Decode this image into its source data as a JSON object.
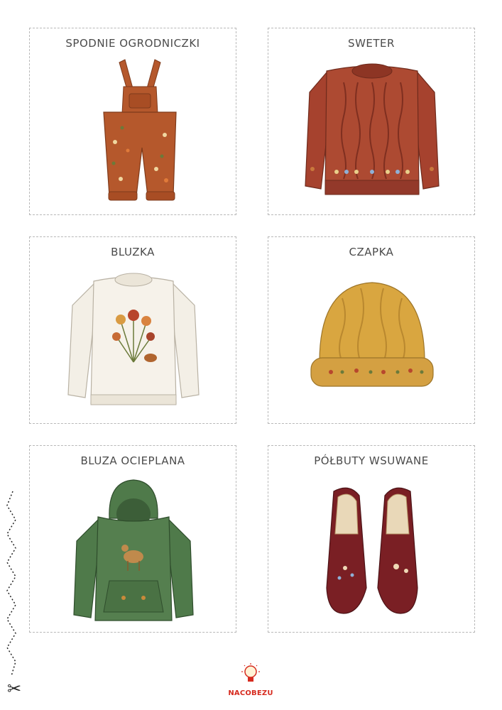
{
  "cards": [
    {
      "label": "SPODNIE OGRODNICZKI",
      "illustration": "overalls"
    },
    {
      "label": "SWETER",
      "illustration": "cable-sweater"
    },
    {
      "label": "BLUZKA",
      "illustration": "sweatshirt"
    },
    {
      "label": "CZAPKA",
      "illustration": "beanie"
    },
    {
      "label": "BLUZA OCIEPLANA",
      "illustration": "hoodie"
    },
    {
      "label": "PÓŁBUTY WSUWANE",
      "illustration": "slip-on-shoes"
    }
  ],
  "footer": {
    "brand": "NACOBEZU",
    "cut_icon": "scissors-icon"
  },
  "colors": {
    "border": "#b8b8b8",
    "rust": "#b5582c",
    "sweater_red": "#a6422e",
    "cream": "#f3efe6",
    "mustard": "#d9a640",
    "green": "#4f7a4a",
    "burgundy": "#7a1f24",
    "brand_red": "#d62b1f"
  }
}
